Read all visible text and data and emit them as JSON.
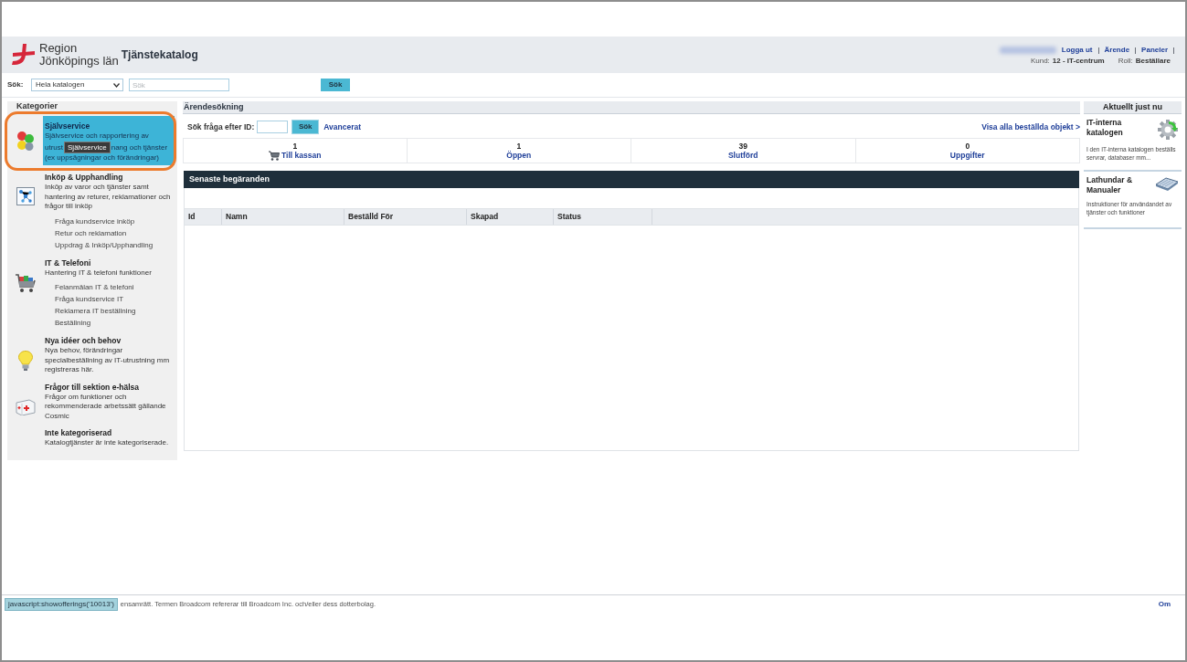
{
  "header": {
    "logo": {
      "lines": [
        "Region",
        "Jönköpings län"
      ]
    },
    "title": "Tjänstekatalog",
    "user_links": [
      "Logga ut",
      "Ärende",
      "Paneler"
    ],
    "customer": {
      "label": "Kund:",
      "value": "12 - IT-centrum"
    },
    "role": {
      "label": "Roll:",
      "value": "Beställare"
    }
  },
  "search": {
    "label": "Sök:",
    "scope": "Hela katalogen",
    "placeholder": "Sök",
    "button": "Sök"
  },
  "sidebar": {
    "title": "Kategorier",
    "items": [
      {
        "title": "Självservice",
        "description": [
          [
            "Självservice och rapportering av"
          ],
          [
            "utrust",
            "nang och tjänster"
          ],
          [
            "(ex uppsägningar och förändringar)"
          ]
        ],
        "tooltip": "Självservice",
        "selected": true,
        "circled": true
      },
      {
        "title": "Inköp & Upphandling",
        "description": [
          [
            "Inköp av varor och tjänster samt hantering av returer, reklamationer och frågor till inköp"
          ]
        ],
        "selected": false,
        "circled": false,
        "children": [
          {
            "label": "Fråga kundservice inköp"
          },
          {
            "label": "Retur och reklamation"
          },
          {
            "label": "Uppdrag & Inköp/Upphandling"
          }
        ]
      },
      {
        "title": "IT & Telefoni",
        "description": [
          [
            "Hantering IT & telefoni funktioner"
          ]
        ],
        "selected": false,
        "circled": false,
        "children": [
          {
            "label": "Felanmälan IT & telefoni"
          },
          {
            "label": "Fråga kundservice IT"
          },
          {
            "label": "Reklamera IT beställning"
          },
          {
            "label": "Beställning"
          }
        ]
      },
      {
        "title": "Nya idéer och behov",
        "description": [
          [
            "Nya behov, förändringar specialbeställning av IT-utrustning mm registreras här."
          ]
        ],
        "selected": false,
        "circled": false
      },
      {
        "title": "Frågor till sektion e-hälsa",
        "description": [
          [
            "Frågor om funktioner och rekommenderade arbetssätt gällande Cosmic"
          ]
        ],
        "selected": false,
        "circled": false
      },
      {
        "title": "Inte kategoriserad",
        "description": [
          [
            "Katalogtjänster är inte kategoriserade."
          ]
        ],
        "selected": false,
        "circled": false
      }
    ]
  },
  "case_search": {
    "title": "Ärendesökning",
    "id_label": "Sök fråga efter ID:",
    "button": "Sök",
    "advanced_link": "Avancerat",
    "view_all_link": "Visa alla beställda objekt >",
    "stats": [
      {
        "count": "1",
        "label": "Till kassan"
      },
      {
        "count": "1",
        "label": "Öppen"
      },
      {
        "count": "39",
        "label": "Slutförd"
      },
      {
        "count": "0",
        "label": "Uppgifter"
      }
    ]
  },
  "recent_requests": {
    "title": "Senaste begäranden",
    "columns": [
      "Id",
      "Namn",
      "Beställd För",
      "Skapad",
      "Status"
    ]
  },
  "right_panel": {
    "title": "Aktuellt just nu",
    "cards": [
      {
        "title": "IT-interna katalogen",
        "description": "I den IT-interna katalogen beställs servrar, databaser mm..."
      },
      {
        "title": "Lathundar & Manualer",
        "description": "Instruktioner för användandet av tjänster och funktioner"
      }
    ]
  },
  "status_bar": {
    "url": "javascript:showofferings('10013')",
    "text": "ensamrätt. Termen Broadcom refererar till Broadcom Inc. och/eller dess dotterbolag.",
    "link": "Om"
  }
}
